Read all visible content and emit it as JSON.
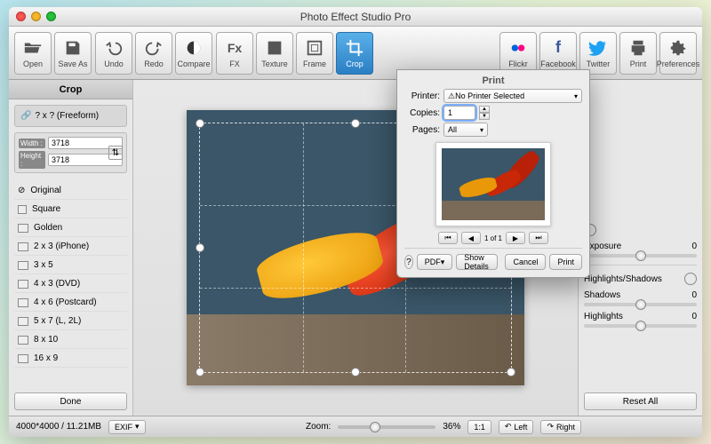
{
  "window": {
    "title": "Photo Effect Studio Pro"
  },
  "toolbar": {
    "open": "Open",
    "save_as": "Save As",
    "undo": "Undo",
    "redo": "Redo",
    "compare": "Compare",
    "fx": "FX",
    "texture": "Texture",
    "frame": "Frame",
    "crop": "Crop",
    "flickr": "Flickr",
    "facebook": "Facebook",
    "twitter": "Twitter",
    "print": "Print",
    "prefs": "Preferences"
  },
  "sidebar": {
    "title": "Crop",
    "freeform": "? x ?  (Freeform)",
    "width": {
      "label": "Width :",
      "value": "3718"
    },
    "height": {
      "label": "Height :",
      "value": "3718"
    },
    "aspects": [
      "Original",
      "Square",
      "Golden",
      "2 x 3  (iPhone)",
      "3 x 5",
      "4 x 3  (DVD)",
      "4 x 6  (Postcard)",
      "5 x 7  (L, 2L)",
      "8 x 10",
      "16 x 9"
    ],
    "done": "Done"
  },
  "adjust": {
    "exposure": {
      "label": "Exposure",
      "value": "0"
    },
    "hs": {
      "label": "Highlights/Shadows"
    },
    "shadows": {
      "label": "Shadows",
      "value": "0"
    },
    "highlights": {
      "label": "Highlights",
      "value": "0"
    },
    "reset": "Reset All"
  },
  "status": {
    "size": "4000*4000 / 11.21MB",
    "exif": "EXIF",
    "zoom_label": "Zoom:",
    "zoom_value": "36%",
    "ratio": "1:1",
    "rot_left": "Left",
    "rot_right": "Right"
  },
  "print": {
    "title": "Print",
    "printer_label": "Printer:",
    "printer_value": "No Printer Selected",
    "copies_label": "Copies:",
    "copies_value": "1",
    "pages_label": "Pages:",
    "pages_value": "All",
    "pager": "1 of 1",
    "pdf": "PDF",
    "show_details": "Show Details",
    "cancel": "Cancel",
    "print_btn": "Print"
  }
}
